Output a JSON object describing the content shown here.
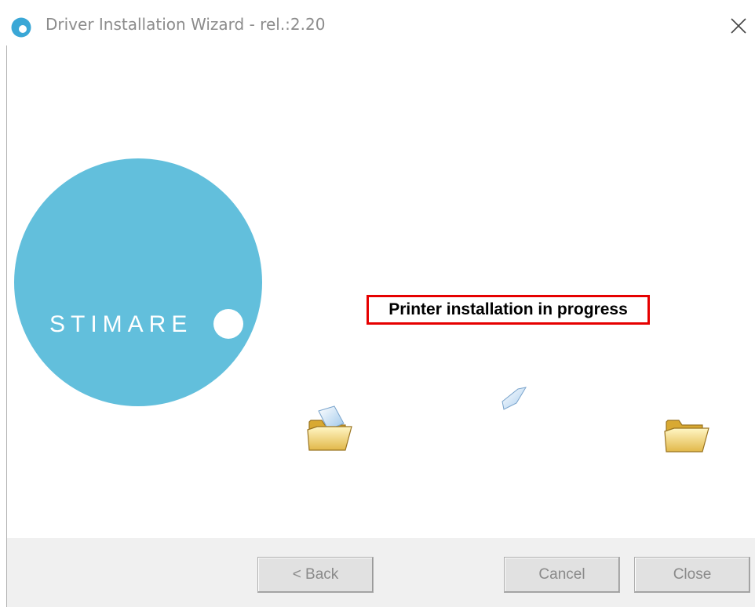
{
  "window": {
    "title": "Driver Installation Wizard - rel.:2.20",
    "close_icon": "close-icon"
  },
  "logo": {
    "text": "STIMARE",
    "color": "#62bfdc"
  },
  "status": {
    "message": "Printer installation in progress",
    "border_color": "#e60000"
  },
  "animation": {
    "source_icon": "folder-open-icon",
    "moving_icon": "document-icon",
    "target_icon": "folder-icon"
  },
  "buttons": {
    "back": "< Back",
    "cancel": "Cancel",
    "close": "Close"
  }
}
